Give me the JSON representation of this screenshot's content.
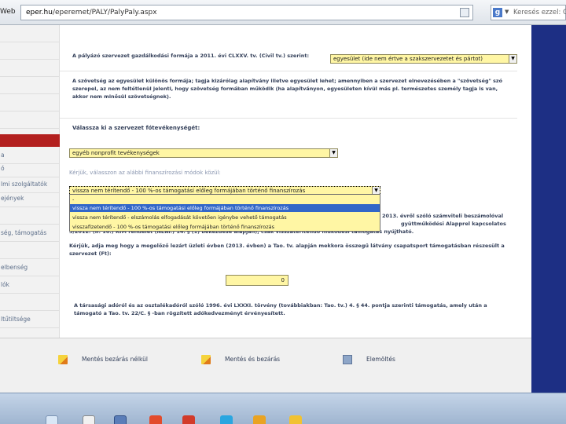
{
  "browser": {
    "app_label": "Web",
    "url_host": "eper.hu",
    "url_path": "/eperemet/PALY/PalyPaly.aspx",
    "search_engine_letter": "g",
    "search_placeholder": "Keresés ezzel: Go"
  },
  "sidebar": {
    "items": [
      {
        "label": ""
      },
      {
        "label": ""
      },
      {
        "label": ""
      },
      {
        "label": ""
      },
      {
        "label": ""
      },
      {
        "label": ""
      },
      {
        "label": "a"
      },
      {
        "label": "ó"
      },
      {
        "label": "lmi szolgáltatók"
      },
      {
        "label": "ejények"
      },
      {
        "label": ""
      },
      {
        "label": "ség, támogatás"
      },
      {
        "label": ""
      },
      {
        "label": "elbenség"
      },
      {
        "label": "lók"
      },
      {
        "label": ""
      },
      {
        "label": "ltűtiltsége"
      }
    ]
  },
  "form": {
    "q1_label": "A pályázó szervezet gazdálkodási formája a 2011. évi CLXXV. tv. (Civil tv.) szerint:",
    "q1_value": "egyesület (ide nem értve a szakszervezetet és pártot)",
    "note": "A szövetség az egyesület különös formája; tagja kizárólag alapítvány illetve egyesület lehet; amennyiben a szervezet elnevezésében a \"szövetség\" szó szerepel, az nem feltétlenül jelenti, hogy szövetség formában működik (ha alapítványon, egyesületen kívül más pl. természetes személy tagja is van, akkor nem minősül szövetségnek).",
    "q2_label": "Válassza ki a szervezet fótevékenységét:",
    "q2_value": "egyéb nonprofit tevékenységek",
    "q3_label": "Kérjük, válasszon az alábbi finanszírozási módok közül:",
    "q3_value": "vissza nem térítendő - 100 %-os támogatási előleg formájában történő finanszírozás",
    "q3_options": [
      "-",
      "vissza nem térítendő - 100 %-os támogatási előleg formájában történő finanszírozás",
      "vissza nem térítendő - elszámolás elfogadását követően igénybe vehető támogatás",
      "visszafizetendő - 100 %-os támogatási előleg formájában történő finanszírozás"
    ],
    "partial_right_1": "2013. évről szóló számviteli beszámolóval",
    "partial_right_2": "gyüttműködési Alapprel kapcsolatos",
    "partial_line_3": "5/2012. (II. 16.) KIM rendelet (NEAr.) 14. § (1) bekezdése alapján), csak visszatérítendő működési támogatás nyújtható.",
    "q4_label": "Kérjük, adja meg hogy a megelőző lezárt üzleti évben (2013. évben) a Tao. tv. alapján mekkora összegű látvány csapatsport támogatásban részesült a szervezet (Ft):",
    "q4_value": "0",
    "tao_text": "A társasági adóról és az osztalékadóról szóló 1996. évi LXXXI. törvény (továbbiakban: Tao. tv.) 4. § 44. pontja szerinti támogatás, amely után a támogató a Tao. tv. 22/C. § -ban rögzített adókedvezményt érvényesített."
  },
  "footer": {
    "btn1": "Mentés bezárás nélkül",
    "btn2": "Mentés és bezárás",
    "btn3": "Elemöltés"
  },
  "colors": {
    "field_yellow": "#fff6a4",
    "accent_blue": "#1d2f84",
    "sidebar_red": "#b3201f",
    "highlight": "#3267c8"
  }
}
